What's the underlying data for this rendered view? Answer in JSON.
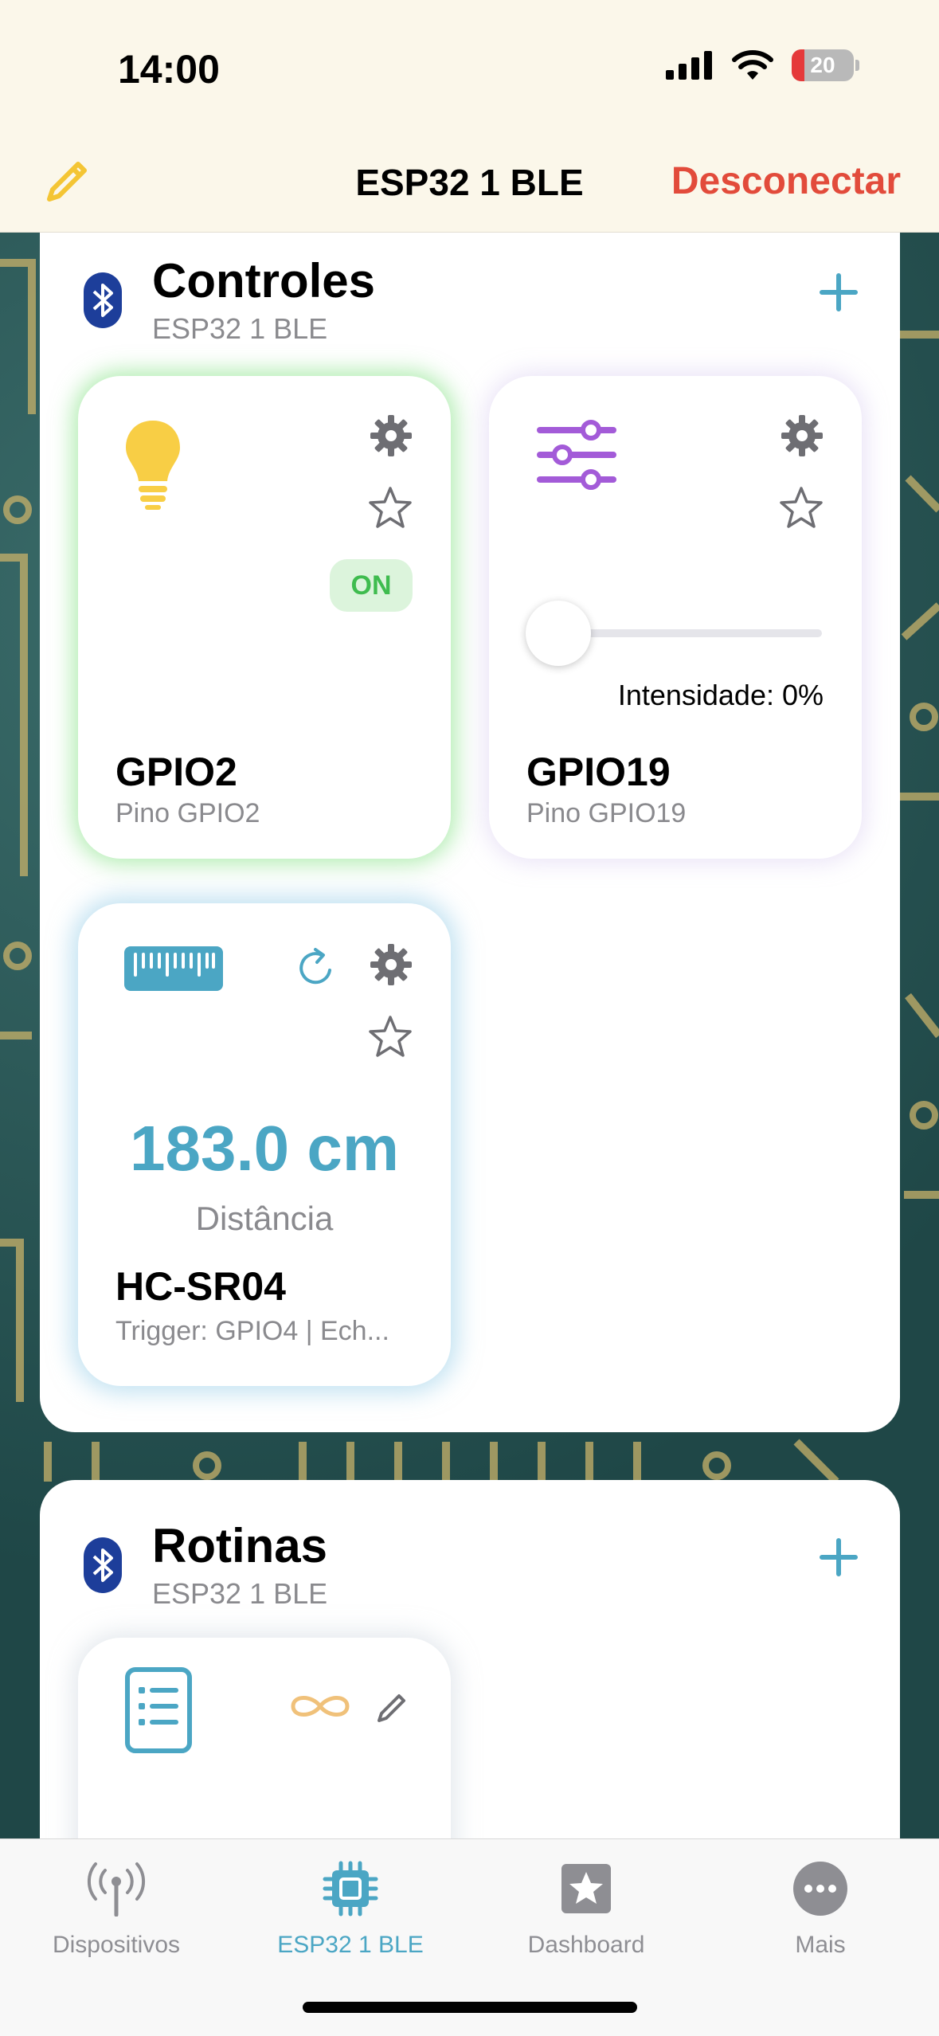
{
  "status_bar": {
    "time": "14:00",
    "battery": "20"
  },
  "nav": {
    "title": "ESP32 1 BLE",
    "disconnect_label": "Desconectar"
  },
  "controls": {
    "title": "Controles",
    "subtitle": "ESP32 1 BLE",
    "tiles": [
      {
        "name": "GPIO2",
        "sub": "Pino GPIO2",
        "state_label": "ON",
        "icon": "lightbulb-icon"
      },
      {
        "name": "GPIO19",
        "sub": "Pino GPIO19",
        "intensity_label": "Intensidade: 0%",
        "slider_value": 0,
        "icon": "sliders-icon"
      },
      {
        "name": "HC-SR04",
        "sub": "Trigger: GPIO4 | Ech...",
        "value": "183.0 cm",
        "value_label": "Distância",
        "icon": "ruler-icon"
      }
    ]
  },
  "routines": {
    "title": "Rotinas",
    "subtitle": "ESP32 1 BLE"
  },
  "tabbar": {
    "items": [
      {
        "label": "Dispositivos",
        "icon": "antenna-icon",
        "active": false
      },
      {
        "label": "ESP32 1 BLE",
        "icon": "chip-icon",
        "active": true
      },
      {
        "label": "Dashboard",
        "icon": "star-square-icon",
        "active": false
      },
      {
        "label": "Mais",
        "icon": "more-icon",
        "active": false
      }
    ]
  },
  "colors": {
    "accent": "#4ba6c4",
    "destructive": "#e24b3b",
    "on_green": "#3fbc4f",
    "slider_purple": "#a35bd8",
    "bulb_yellow": "#f8ce45",
    "bluetooth_blue": "#1d3e9a"
  }
}
